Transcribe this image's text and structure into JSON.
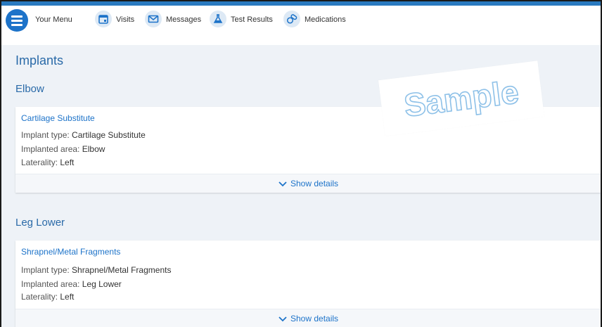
{
  "nav": {
    "menu_label": "Your Menu",
    "items": [
      {
        "label": "Visits",
        "icon": "calendar-icon"
      },
      {
        "label": "Messages",
        "icon": "envelope-icon"
      },
      {
        "label": "Test Results",
        "icon": "flask-icon"
      },
      {
        "label": "Medications",
        "icon": "pills-icon"
      }
    ]
  },
  "page": {
    "title": "Implants",
    "watermark_text": "Sample"
  },
  "sections": [
    {
      "title": "Elbow",
      "card": {
        "title": "Cartilage Substitute",
        "implant_type_label": "Implant type:",
        "implant_type": "Cartilage Substitute",
        "area_label": "Implanted area:",
        "area": "Elbow",
        "laterality_label": "Laterality:",
        "laterality": "Left",
        "show_details": "Show details"
      }
    },
    {
      "title": "Leg Lower",
      "card": {
        "title": "Shrapnel/Metal Fragments",
        "implant_type_label": "Implant type:",
        "implant_type": "Shrapnel/Metal Fragments",
        "area_label": "Implanted area:",
        "area": "Leg Lower",
        "laterality_label": "Laterality:",
        "laterality": "Left",
        "show_details": "Show details"
      }
    }
  ],
  "colors": {
    "accent": "#1d73c9",
    "heading": "#2a6aa8",
    "background": "#eef2f7"
  }
}
